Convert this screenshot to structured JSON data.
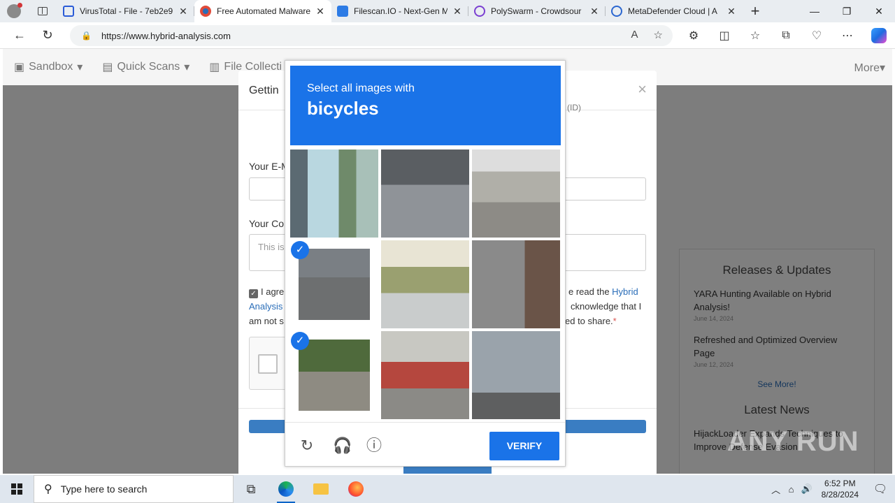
{
  "browser": {
    "tabs": [
      {
        "title": "VirusTotal - File - 7eb2e9",
        "color": "#2a5bd7"
      },
      {
        "title": "Free Automated Malware",
        "color": "#e04b3a",
        "active": true
      },
      {
        "title": "Filescan.IO - Next-Gen M",
        "color": "#2c7be5"
      },
      {
        "title": "PolySwarm - Crowdsour",
        "color": "#7a3fd1"
      },
      {
        "title": "MetaDefender Cloud | A",
        "color": "#2a66d0"
      }
    ],
    "url": "https://www.hybrid-analysis.com"
  },
  "site": {
    "nav": [
      "Sandbox",
      "Quick Scans",
      "File Collecti"
    ],
    "nav_more": "More"
  },
  "modal": {
    "title": "Gettin",
    "title_tail": "(ID)",
    "email_label": "Your E-M",
    "comment_label": "Your Co",
    "comment_placeholder": "This is",
    "agree_left_1": "I agre",
    "agree_left_2": "Analysis",
    "agree_left_3": "am not s",
    "agree_right_1": "e read the",
    "agree_link": "Hybrid",
    "agree_right_2": "cknowledge that I",
    "agree_right_3": "ed to share.",
    "required": "*"
  },
  "captcha": {
    "instruction": "Select all images with",
    "target": "bicycles",
    "verify_label": "VERIFY"
  },
  "sidebar": {
    "releases_title": "Releases & Updates",
    "releases": [
      {
        "title": "YARA Hunting Available on Hybrid Analysis!",
        "date": "June 14, 2024"
      },
      {
        "title": "Refreshed and Optimized Overview Page",
        "date": "June 12, 2024"
      }
    ],
    "see_more": "See More!",
    "news_title": "Latest News",
    "news": [
      {
        "title": "HijackLoader Expands Techniques to Improve Defense Evasion"
      }
    ]
  },
  "watermark": "ANY RUN",
  "taskbar": {
    "search_placeholder": "Type here to search",
    "time": "6:52 PM",
    "date": "8/28/2024"
  }
}
